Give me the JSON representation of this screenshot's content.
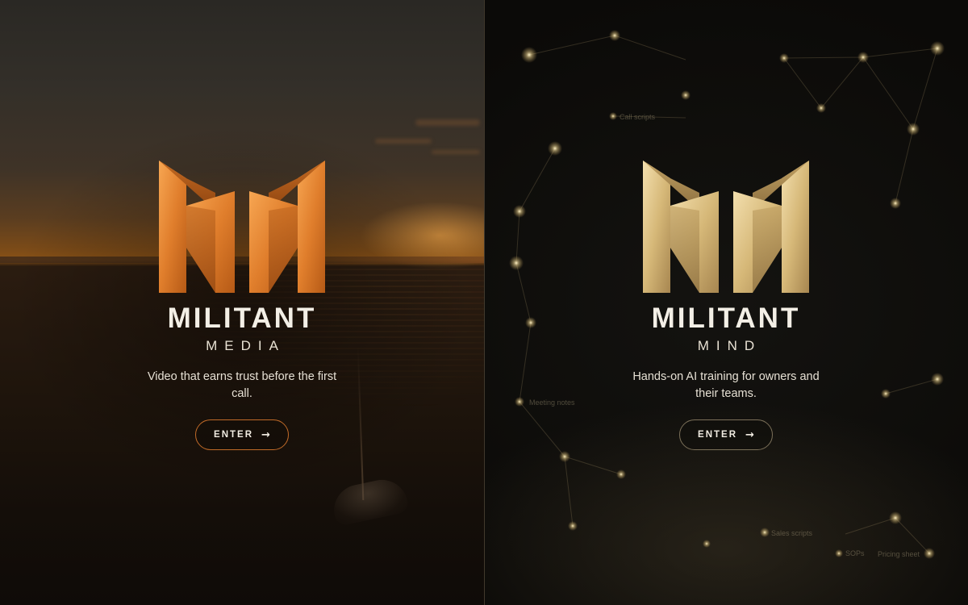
{
  "media": {
    "wordmark": "MILITANT",
    "subword": "MEDIA",
    "tagline": "Video that earns trust before the first call.",
    "enter_label": "ENTER",
    "arrow": "→",
    "accent": "#e68a34",
    "button_border": "#c06a28"
  },
  "mind": {
    "wordmark": "MILITANT",
    "subword": "MIND",
    "tagline": "Hands-on AI training for owners and their teams.",
    "enter_label": "ENTER",
    "arrow": "→",
    "accent": "#d8bf82",
    "button_border": "#7b7059",
    "constellation_labels": [
      "Call scripts",
      "Meeting notes",
      "Sales scripts",
      "SOPs",
      "Pricing sheet"
    ]
  }
}
